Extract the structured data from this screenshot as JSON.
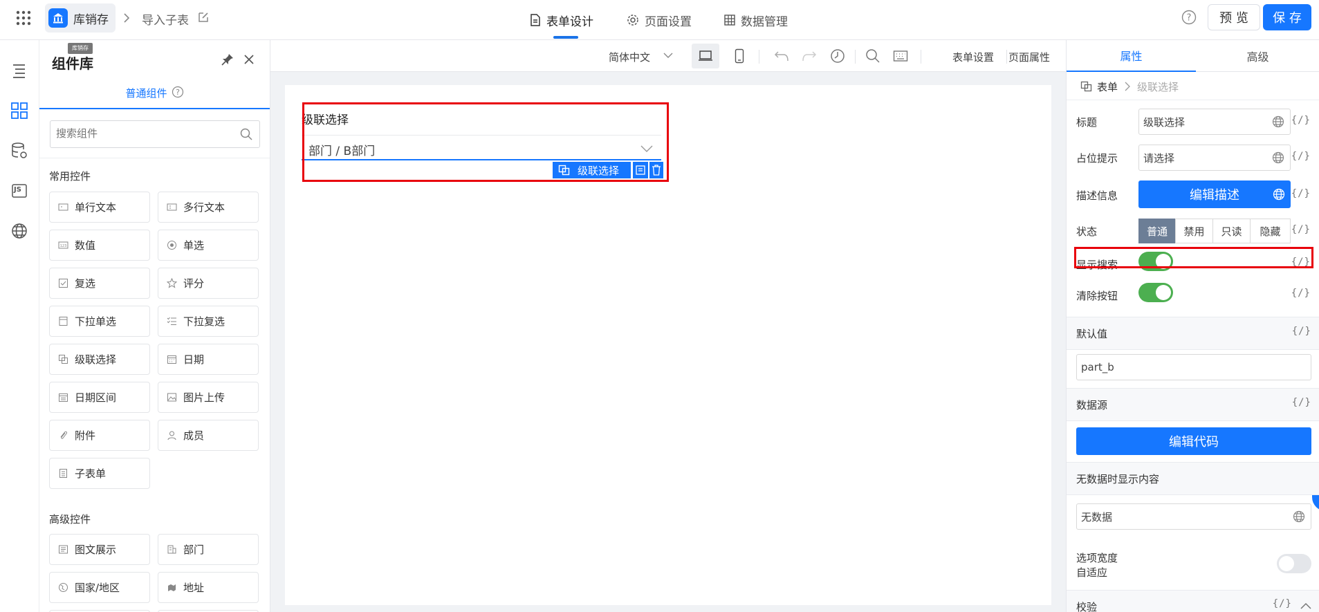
{
  "header": {
    "app_name": "库销存",
    "app_tooltip": "库销存",
    "breadcrumb_page": "导入子表",
    "tabs": [
      {
        "label": "表单设计",
        "active": true
      },
      {
        "label": "页面设置",
        "active": false
      },
      {
        "label": "数据管理",
        "active": false
      }
    ],
    "preview_label": "预 览",
    "save_label": "保 存",
    "accent": "#1677ff"
  },
  "rail": {
    "icons": [
      "outline-icon",
      "components-icon",
      "datasource-icon",
      "js-icon",
      "globe-icon"
    ],
    "js_label": "JS"
  },
  "panel": {
    "title": "组件库",
    "tab_label": "普通组件",
    "search_placeholder": "搜索组件",
    "common_title": "常用控件",
    "common": [
      {
        "label": "单行文本",
        "icon": "single-line-text-icon"
      },
      {
        "label": "多行文本",
        "icon": "multi-line-text-icon"
      },
      {
        "label": "数值",
        "icon": "number-icon"
      },
      {
        "label": "单选",
        "icon": "radio-icon"
      },
      {
        "label": "复选",
        "icon": "checkbox-icon"
      },
      {
        "label": "评分",
        "icon": "star-icon"
      },
      {
        "label": "下拉单选",
        "icon": "dropdown-icon"
      },
      {
        "label": "下拉复选",
        "icon": "dropdown-multi-icon"
      },
      {
        "label": "级联选择",
        "icon": "cascader-icon"
      },
      {
        "label": "日期",
        "icon": "calendar-icon"
      },
      {
        "label": "日期区间",
        "icon": "date-range-icon"
      },
      {
        "label": "图片上传",
        "icon": "image-upload-icon"
      },
      {
        "label": "附件",
        "icon": "attachment-icon"
      },
      {
        "label": "成员",
        "icon": "member-icon"
      },
      {
        "label": "子表单",
        "icon": "subform-icon"
      }
    ],
    "advanced_title": "高级控件",
    "advanced": [
      {
        "label": "图文展示",
        "icon": "rich-text-icon"
      },
      {
        "label": "部门",
        "icon": "department-icon"
      },
      {
        "label": "国家/地区",
        "icon": "country-icon"
      },
      {
        "label": "地址",
        "icon": "address-icon"
      }
    ]
  },
  "toolbar": {
    "language": "简体中文",
    "form_settings": "表单设置",
    "page_props": "页面属性"
  },
  "canvas": {
    "field_label": "级联选择",
    "field_value": "部门 / B部门",
    "selected_tag": "级联选择"
  },
  "props": {
    "tabs": [
      "属性",
      "高级"
    ],
    "breadcrumb_root": "表单",
    "breadcrumb_current": "级联选择",
    "code_label": "{/}",
    "title_label": "标题",
    "title_value": "级联选择",
    "placeholder_label": "占位提示",
    "placeholder_value": "请选择",
    "desc_label": "描述信息",
    "desc_button": "编辑描述",
    "status_label": "状态",
    "status_options": [
      "普通",
      "禁用",
      "只读",
      "隐藏"
    ],
    "status_selected": "普通",
    "show_search_label": "显示搜索",
    "show_search_on": true,
    "clear_label": "清除按钮",
    "clear_on": true,
    "default_label": "默认值",
    "default_value": "part_b",
    "datasource_label": "数据源",
    "edit_code_button": "编辑代码",
    "nodata_label": "无数据时显示内容",
    "nodata_value": "无数据",
    "autowidth_label_line1": "选项宽度",
    "autowidth_label_line2": "自适应",
    "autowidth_on": false,
    "validate_label": "校验"
  }
}
